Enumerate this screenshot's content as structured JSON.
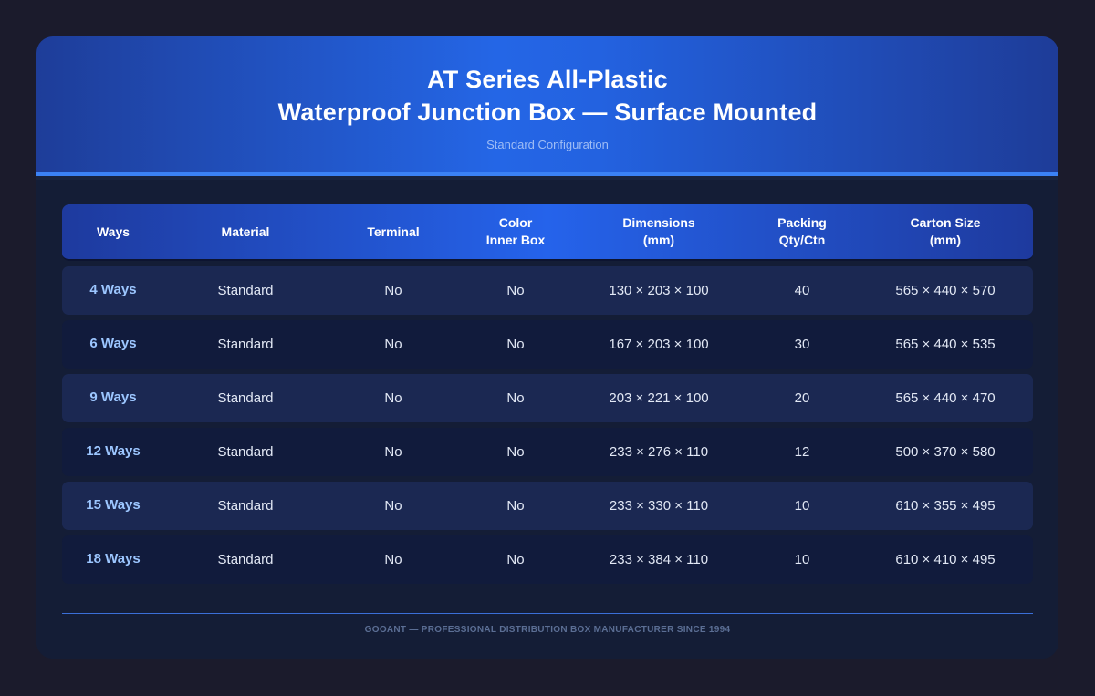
{
  "header": {
    "title_line1": "AT Series All-Plastic",
    "title_line2": "Waterproof Junction Box — Surface Mounted",
    "subtitle": "Standard Configuration"
  },
  "table": {
    "columns": [
      "Ways",
      "Material",
      "Terminal",
      "Color\nInner Box",
      "Dimensions\n(mm)",
      "Packing\nQty/Ctn",
      "Carton Size\n(mm)"
    ],
    "rows": [
      [
        "4 Ways",
        "Standard",
        "No",
        "No",
        "130 × 203 × 100",
        "40",
        "565 × 440 × 570"
      ],
      [
        "6 Ways",
        "Standard",
        "No",
        "No",
        "167 × 203 × 100",
        "30",
        "565 × 440 × 535"
      ],
      [
        "9 Ways",
        "Standard",
        "No",
        "No",
        "203 × 221 × 100",
        "20",
        "565 × 440 × 470"
      ],
      [
        "12 Ways",
        "Standard",
        "No",
        "No",
        "233 × 276 × 110",
        "12",
        "500 × 370 × 580"
      ],
      [
        "15 Ways",
        "Standard",
        "No",
        "No",
        "233 × 330 × 110",
        "10",
        "610 × 355 × 495"
      ],
      [
        "18 Ways",
        "Standard",
        "No",
        "No",
        "233 × 384 × 110",
        "10",
        "610 × 410 × 495"
      ]
    ]
  },
  "footer": {
    "text": "GOOANT — PROFESSIONAL DISTRIBUTION BOX MANUFACTURER SINCE 1994"
  },
  "colors": {
    "accent": "#3b82f6",
    "header_blue": "#2466e6",
    "ways_text": "#9cc6ff"
  }
}
